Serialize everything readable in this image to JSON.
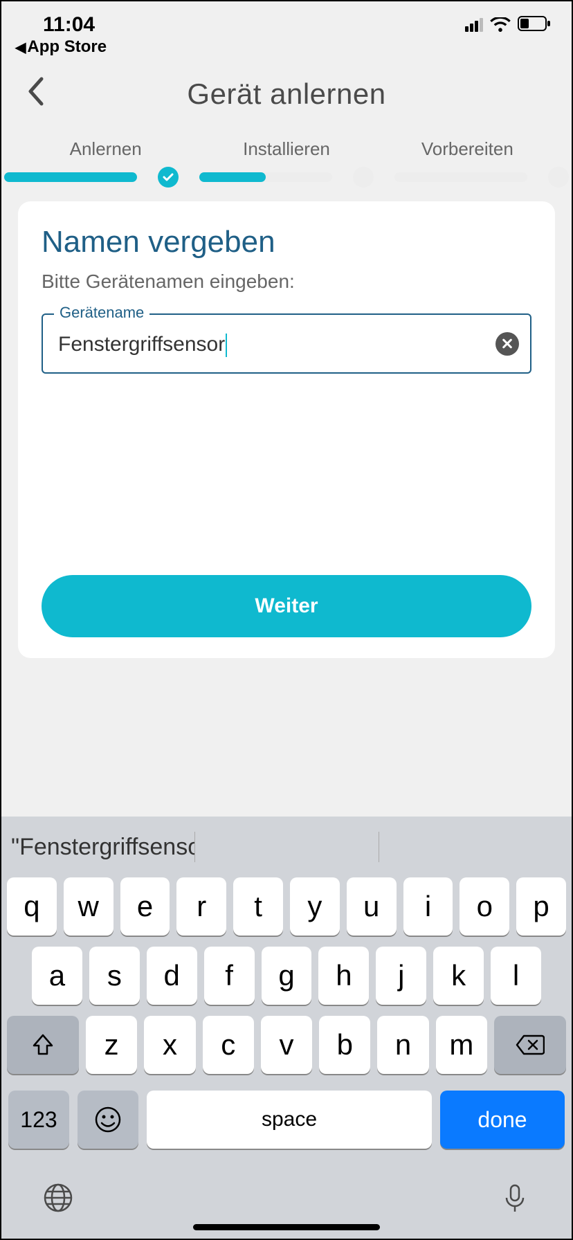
{
  "status": {
    "time": "11:04",
    "breadcrumb": "App Store"
  },
  "header": {
    "title": "Gerät anlernen"
  },
  "steps": {
    "labels": [
      "Anlernen",
      "Installieren",
      "Vorbereiten"
    ]
  },
  "card": {
    "title": "Namen vergeben",
    "subtitle": "Bitte Gerätenamen eingeben:",
    "input_label": "Gerätename",
    "input_value": "Fenstergriffsensor",
    "primary_button": "Weiter"
  },
  "keyboard": {
    "suggestion": "\"Fenstergriffsensor\"",
    "rows": {
      "r1": [
        "q",
        "w",
        "e",
        "r",
        "t",
        "y",
        "u",
        "i",
        "o",
        "p"
      ],
      "r2": [
        "a",
        "s",
        "d",
        "f",
        "g",
        "h",
        "j",
        "k",
        "l"
      ],
      "r3": [
        "z",
        "x",
        "c",
        "v",
        "b",
        "n",
        "m"
      ]
    },
    "numkey": "123",
    "space": "space",
    "done": "done"
  }
}
